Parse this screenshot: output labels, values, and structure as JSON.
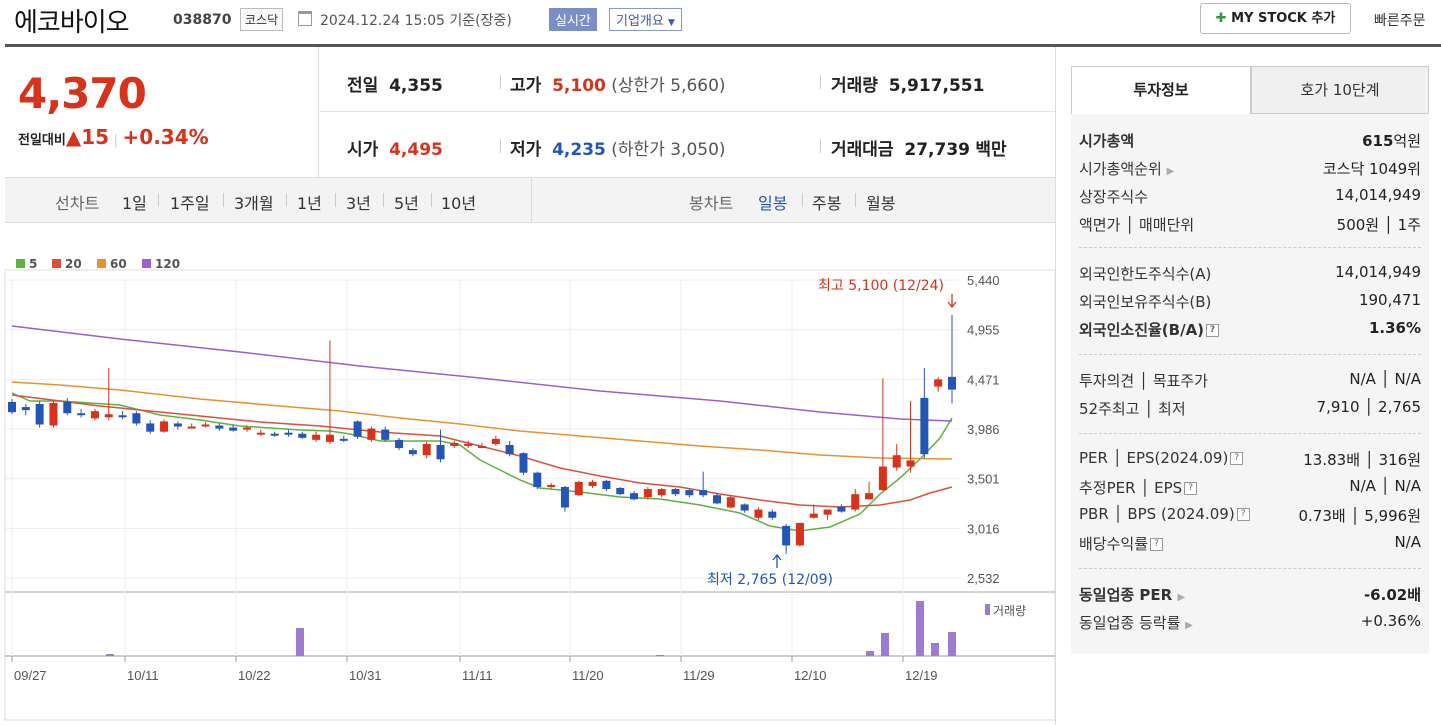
{
  "header": {
    "name": "에코바이오",
    "code": "038870",
    "market": "코스닥",
    "datetime": "2024.12.24 15:05 기준(장중)",
    "realtime": "실시간",
    "company_info": "기업개요",
    "mystock": "MY STOCK 추가",
    "quick_order": "빠른주문"
  },
  "price": {
    "current": "4,370",
    "diff_label": "전일대비",
    "diff_arrow": "▲",
    "diff_value": "15",
    "diff_pct": "+0.34%"
  },
  "stats": {
    "prev_label": "전일",
    "prev": "4,355",
    "high_label": "고가",
    "high": "5,100",
    "upper_limit": "(상한가 5,660)",
    "volume_label": "거래량",
    "volume": "5,917,551",
    "open_label": "시가",
    "open": "4,495",
    "low_label": "저가",
    "low": "4,235",
    "lower_limit": "(하한가 3,050)",
    "amount_label": "거래대금",
    "amount": "27,739",
    "amount_unit": "백만"
  },
  "toolbar": {
    "line_label": "선차트",
    "periods": [
      "1일",
      "1주일",
      "3개월",
      "1년",
      "3년",
      "5년",
      "10년"
    ],
    "candle_label": "봉차트",
    "candles": [
      "일봉",
      "주봉",
      "월봉"
    ]
  },
  "chart_data": {
    "type": "candlestick",
    "legend": [
      "5",
      "20",
      "60",
      "120"
    ],
    "ma_colors": [
      "#5db33f",
      "#d9503f",
      "#e8922e",
      "#9a5fd0"
    ],
    "y_ticks": [
      "5,440",
      "4,955",
      "4,471",
      "3,986",
      "3,501",
      "3,016",
      "2,532"
    ],
    "y_range": [
      2532,
      5440
    ],
    "x_labels": [
      "09/27",
      "10/11",
      "10/22",
      "10/31",
      "11/11",
      "11/20",
      "11/29",
      "12/10",
      "12/19"
    ],
    "high_note": "최고 5,100 (12/24)",
    "low_note": "최저 2,765 (12/09)",
    "volume_label": "거래량",
    "candles": [
      [
        4250,
        4150,
        4280,
        4130
      ],
      [
        4200,
        4170,
        4230,
        4120
      ],
      [
        4230,
        4030,
        4260,
        4000
      ],
      [
        4020,
        4240,
        4260,
        4000
      ],
      [
        4250,
        4140,
        4290,
        4120
      ],
      [
        4140,
        4130,
        4180,
        4100
      ],
      [
        4090,
        4160,
        4180,
        4070
      ],
      [
        4100,
        4130,
        4580,
        4070
      ],
      [
        4120,
        4110,
        4160,
        4080
      ],
      [
        4140,
        4040,
        4160,
        4020
      ],
      [
        4040,
        3960,
        4070,
        3940
      ],
      [
        3960,
        4060,
        4080,
        3950
      ],
      [
        4040,
        4010,
        4060,
        3980
      ],
      [
        4000,
        4010,
        4040,
        3990
      ],
      [
        4020,
        4030,
        4050,
        4000
      ],
      [
        4020,
        3990,
        4040,
        3970
      ],
      [
        4000,
        3970,
        4030,
        3960
      ],
      [
        3980,
        4000,
        4020,
        3960
      ],
      [
        3940,
        3950,
        3980,
        3920
      ],
      [
        3940,
        3930,
        3960,
        3910
      ],
      [
        3950,
        3930,
        3980,
        3910
      ],
      [
        3940,
        3900,
        3960,
        3890
      ],
      [
        3880,
        3930,
        3960,
        3860
      ],
      [
        3860,
        3930,
        4850,
        3840
      ],
      [
        3890,
        3880,
        3920,
        3860
      ],
      [
        4060,
        3910,
        4070,
        3890
      ],
      [
        3880,
        3990,
        4010,
        3860
      ],
      [
        3980,
        3880,
        4010,
        3860
      ],
      [
        3880,
        3800,
        3900,
        3780
      ],
      [
        3780,
        3740,
        3800,
        3720
      ],
      [
        3730,
        3840,
        3860,
        3700
      ],
      [
        3830,
        3690,
        3980,
        3660
      ],
      [
        3820,
        3850,
        3870,
        3800
      ],
      [
        3830,
        3840,
        3870,
        3800
      ],
      [
        3820,
        3820,
        3850,
        3800
      ],
      [
        3840,
        3890,
        3920,
        3820
      ],
      [
        3830,
        3740,
        3870,
        3720
      ],
      [
        3750,
        3560,
        3760,
        3540
      ],
      [
        3560,
        3420,
        3570,
        3400
      ],
      [
        3420,
        3440,
        3460,
        3400
      ],
      [
        3420,
        3220,
        3430,
        3180
      ],
      [
        3340,
        3470,
        3480,
        3330
      ],
      [
        3430,
        3470,
        3490,
        3410
      ],
      [
        3480,
        3400,
        3490,
        3380
      ],
      [
        3410,
        3350,
        3420,
        3340
      ],
      [
        3360,
        3300,
        3380,
        3290
      ],
      [
        3320,
        3400,
        3420,
        3300
      ],
      [
        3340,
        3400,
        3410,
        3320
      ],
      [
        3400,
        3350,
        3410,
        3330
      ],
      [
        3390,
        3340,
        3400,
        3320
      ],
      [
        3390,
        3340,
        3570,
        3320
      ],
      [
        3340,
        3260,
        3360,
        3250
      ],
      [
        3220,
        3320,
        3340,
        3210
      ],
      [
        3250,
        3190,
        3260,
        3170
      ],
      [
        3120,
        3200,
        3220,
        3100
      ],
      [
        3180,
        3120,
        3200,
        3100
      ],
      [
        3040,
        2850,
        3060,
        2765
      ],
      [
        2850,
        3070,
        3070,
        2840
      ],
      [
        3120,
        3160,
        3250,
        3110
      ],
      [
        3150,
        3200,
        3200,
        3100
      ],
      [
        3230,
        3180,
        3250,
        3170
      ],
      [
        3200,
        3350,
        3400,
        3180
      ],
      [
        3300,
        3360,
        3470,
        3300
      ],
      [
        3390,
        3620,
        4480,
        3380
      ],
      [
        3610,
        3730,
        3840,
        3580
      ],
      [
        3620,
        3680,
        4260,
        3560
      ],
      [
        4290,
        3740,
        4580,
        3700
      ],
      [
        4400,
        4470,
        4490,
        4350
      ],
      [
        4495,
        4370,
        5100,
        4235
      ]
    ],
    "ma5": [
      [
        12,
        393
      ],
      [
        30,
        401
      ],
      [
        60,
        401
      ],
      [
        120,
        405
      ],
      [
        160,
        415
      ],
      [
        200,
        420
      ],
      [
        240,
        426
      ],
      [
        270,
        428
      ],
      [
        300,
        430
      ],
      [
        330,
        431
      ],
      [
        350,
        434
      ],
      [
        380,
        441
      ],
      [
        410,
        441
      ],
      [
        440,
        441
      ],
      [
        460,
        445
      ],
      [
        480,
        460
      ],
      [
        500,
        470
      ],
      [
        520,
        480
      ],
      [
        540,
        488
      ],
      [
        580,
        492
      ],
      [
        620,
        497
      ],
      [
        660,
        499
      ],
      [
        700,
        505
      ],
      [
        740,
        513
      ],
      [
        770,
        526
      ],
      [
        800,
        531
      ],
      [
        830,
        527
      ],
      [
        860,
        514
      ],
      [
        880,
        494
      ],
      [
        900,
        478
      ],
      [
        920,
        459
      ],
      [
        940,
        438
      ],
      [
        952,
        418
      ]
    ],
    "ma20": [
      [
        12,
        395
      ],
      [
        100,
        406
      ],
      [
        180,
        414
      ],
      [
        260,
        422
      ],
      [
        320,
        426
      ],
      [
        380,
        432
      ],
      [
        440,
        436
      ],
      [
        480,
        446
      ],
      [
        520,
        456
      ],
      [
        560,
        468
      ],
      [
        600,
        476
      ],
      [
        640,
        483
      ],
      [
        680,
        487
      ],
      [
        720,
        494
      ],
      [
        760,
        500
      ],
      [
        800,
        505
      ],
      [
        840,
        507
      ],
      [
        880,
        505
      ],
      [
        910,
        500
      ],
      [
        930,
        493
      ],
      [
        952,
        487
      ]
    ],
    "ma60": [
      [
        12,
        382
      ],
      [
        60,
        385
      ],
      [
        120,
        390
      ],
      [
        200,
        399
      ],
      [
        280,
        406
      ],
      [
        340,
        411
      ],
      [
        400,
        418
      ],
      [
        460,
        424
      ],
      [
        520,
        431
      ],
      [
        580,
        436
      ],
      [
        640,
        441
      ],
      [
        700,
        446
      ],
      [
        760,
        450
      ],
      [
        820,
        455
      ],
      [
        880,
        458
      ],
      [
        952,
        459
      ]
    ],
    "ma120": [
      [
        12,
        326
      ],
      [
        120,
        339
      ],
      [
        240,
        352
      ],
      [
        360,
        366
      ],
      [
        480,
        378
      ],
      [
        600,
        391
      ],
      [
        720,
        401
      ],
      [
        820,
        412
      ],
      [
        900,
        419
      ],
      [
        952,
        421
      ]
    ],
    "volume_bars": [
      [
        300,
        28
      ],
      [
        885,
        23
      ],
      [
        920,
        55
      ],
      [
        935,
        13
      ],
      [
        952,
        24
      ],
      [
        870,
        5
      ],
      [
        110,
        2
      ],
      [
        660,
        1
      ]
    ]
  },
  "right_panel": {
    "tab_invest": "투자정보",
    "tab_hoga": "호가 10단계",
    "market_cap_label": "시가총액",
    "market_cap": "615",
    "market_cap_unit": "억원",
    "rank_label": "시가총액순위",
    "rank": "코스닥 1049위",
    "shares_label": "상장주식수",
    "shares": "14,014,949",
    "face_label": "액면가 │ 매매단위",
    "face": "500원 │ 1주",
    "foreign_limit_label": "외국인한도주식수(A)",
    "foreign_limit": "14,014,949",
    "foreign_hold_label": "외국인보유주식수(B)",
    "foreign_hold": "190,471",
    "foreign_ratio_label": "외국인소진율(B/A)",
    "foreign_ratio": "1.36%",
    "opinion_label": "투자의견 │ 목표주가",
    "opinion": "N/A │ N/A",
    "w52_label": "52주최고 │ 최저",
    "w52": "7,910 │ 2,765",
    "per_label": "PER │ EPS(2024.09)",
    "per": "13.83배 │ 316원",
    "eper_label": "추정PER │ EPS",
    "eper": "N/A │ N/A",
    "pbr_label": "PBR │ BPS (2024.09)",
    "pbr": "0.73배 │ 5,996원",
    "div_label": "배당수익률",
    "div": "N/A",
    "sector_per_label": "동일업종 PER",
    "sector_per": "-6.02배",
    "sector_rate_label": "동일업종 등락률",
    "sector_rate": "+0.36%"
  }
}
